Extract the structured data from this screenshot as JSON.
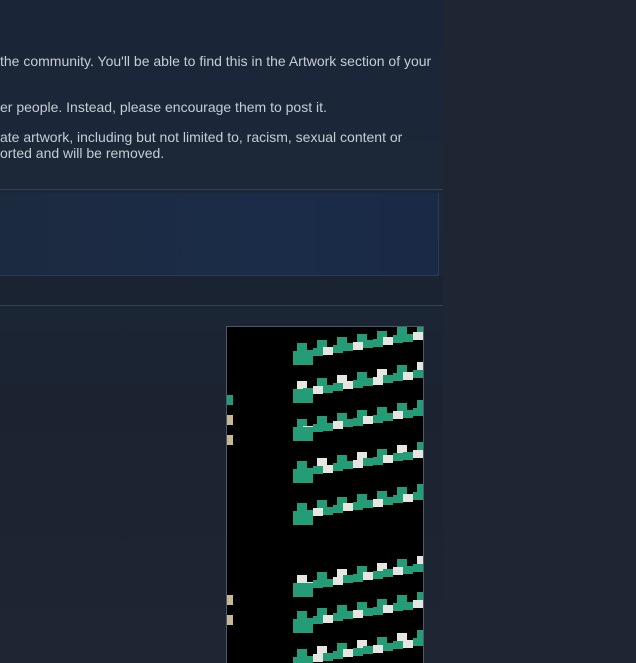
{
  "rules": {
    "line1": "the community. You'll be able to find this in the Artwork section of your",
    "line2": "er people. Instead, please encourage them to post it.",
    "line3": "ate artwork, including but not limited to, racism, sexual content or",
    "line4": "orted and will be removed."
  },
  "preview": {
    "palette": {
      "background": "#000000",
      "teal": "#239c77",
      "white": "#e6e6e0",
      "tan": "#c8b894"
    }
  },
  "colors": {
    "text": "#c6ccd4",
    "panel": "#1a2637",
    "page_bg": "#1e2634",
    "divider": "#344257"
  }
}
